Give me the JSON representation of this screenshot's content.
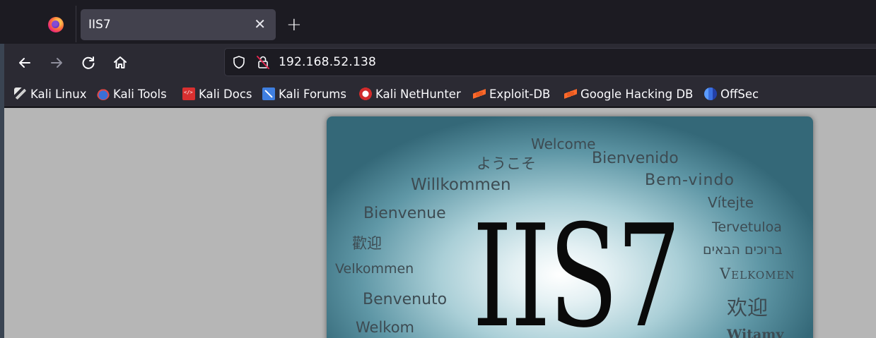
{
  "tabs": [
    {
      "title": "IIS7"
    }
  ],
  "urlbar": {
    "url": "192.168.52.138"
  },
  "bookmarks": [
    {
      "label": "Kali Linux",
      "icon": "kali-dragon-icon"
    },
    {
      "label": "Kali Tools",
      "icon": "kali-tools-icon"
    },
    {
      "label": "Kali Docs",
      "icon": "kali-docs-icon"
    },
    {
      "label": "Kali Forums",
      "icon": "kali-forums-icon"
    },
    {
      "label": "Kali NetHunter",
      "icon": "kali-nethunter-icon"
    },
    {
      "label": "Exploit-DB",
      "icon": "exploit-db-icon"
    },
    {
      "label": "Google Hacking DB",
      "icon": "exploit-db-icon"
    },
    {
      "label": "OffSec",
      "icon": "offsec-icon"
    }
  ],
  "iis": {
    "logo": "IIS7",
    "greetings": {
      "welcome": "Welcome",
      "youkoso": "ようこそ",
      "bienvenido": "Bienvenido",
      "bemvindo": "Bem-vindo",
      "willkommen": "Willkommen",
      "vitejte": "Vítejte",
      "bienvenue": "Bienvenue",
      "tervetuloa": "Tervetuloa",
      "huanying_trad": "歡迎",
      "hebrew": "ברוכים הבאים",
      "velkommen": "Velkommen",
      "velkomen": "Velkomen",
      "benvenuto": "Benvenuto",
      "huanying_simp": "欢迎",
      "welkom": "Welkom",
      "witamy": "Witamy"
    }
  },
  "colors": {
    "toolbar": "#2b2a33",
    "tabstrip": "#1c1b22",
    "active_tab": "#42414d",
    "page_bg": "#b6b6b6"
  }
}
